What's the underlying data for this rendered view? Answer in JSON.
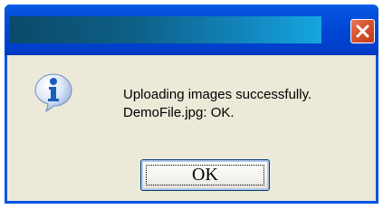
{
  "dialog": {
    "title": "",
    "message_line1": "Uploading images successfully.",
    "message_line2": "DemoFile.jpg: OK.",
    "ok_label": "OK",
    "icon": "info-icon",
    "close_icon": "close-icon"
  },
  "colors": {
    "titlebar": "#0046d5",
    "dialog_body": "#ece9d8",
    "close_button": "#d9532f",
    "info_icon": "#1b5fbd"
  }
}
